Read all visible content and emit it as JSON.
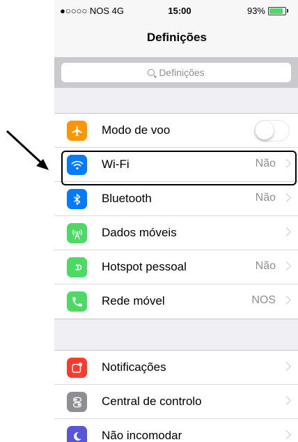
{
  "status_bar": {
    "carrier": "●○○○○ NOS  4G",
    "time": "15:00",
    "battery_percent": "93%",
    "battery_level": 0.93
  },
  "header": {
    "title": "Definições"
  },
  "search": {
    "placeholder": "Definições"
  },
  "colors": {
    "airplane": "#ff9500",
    "wifi": "#007aff",
    "bluetooth": "#007aff",
    "cellular": "#4cd964",
    "hotspot": "#4cd964",
    "carrier": "#4cd964",
    "notifications": "#ff3b30",
    "control_center": "#8e8e93",
    "dnd": "#5856d6"
  },
  "group1": {
    "items": [
      {
        "label": "Modo de voo",
        "icon": "airplane-icon",
        "toggle": false
      },
      {
        "label": "Wi-Fi",
        "value": "Não",
        "icon": "wifi-icon"
      },
      {
        "label": "Bluetooth",
        "value": "Não",
        "icon": "bluetooth-icon"
      },
      {
        "label": "Dados móveis",
        "value": "",
        "icon": "antenna-icon"
      },
      {
        "label": "Hotspot pessoal",
        "value": "Não",
        "icon": "hotspot-icon"
      },
      {
        "label": "Rede móvel",
        "value": "NOS",
        "icon": "phone-icon"
      }
    ]
  },
  "group2": {
    "items": [
      {
        "label": "Notificações",
        "icon": "notifications-icon"
      },
      {
        "label": "Central de controlo",
        "icon": "control-center-icon"
      },
      {
        "label": "Não incomodar",
        "icon": "moon-icon"
      }
    ]
  }
}
